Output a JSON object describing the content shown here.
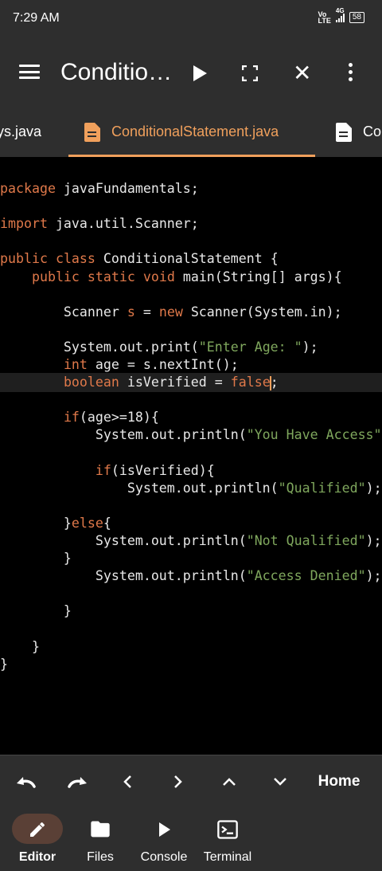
{
  "status": {
    "time": "7:29 AM",
    "volte_top": "Vo",
    "volte_bottom": "LTE",
    "network": "4G",
    "battery": "58"
  },
  "app_bar": {
    "title": "Conditio…"
  },
  "tabs": [
    {
      "label": "ys.java"
    },
    {
      "label": "ConditionalStatement.java"
    },
    {
      "label": "Co"
    }
  ],
  "code": [
    [
      {
        "t": "package",
        "c": "kw"
      },
      {
        "t": " javaFundamentals;"
      }
    ],
    [],
    [
      {
        "t": "import",
        "c": "kw"
      },
      {
        "t": " java.util.Scanner;"
      }
    ],
    [],
    [
      {
        "t": "public",
        "c": "kw"
      },
      {
        "t": " "
      },
      {
        "t": "class",
        "c": "kw"
      },
      {
        "t": " ConditionalStatement {"
      }
    ],
    [
      {
        "t": "    "
      },
      {
        "t": "public",
        "c": "kw"
      },
      {
        "t": " "
      },
      {
        "t": "static",
        "c": "kw"
      },
      {
        "t": " "
      },
      {
        "t": "void",
        "c": "kw"
      },
      {
        "t": " main(String[] args){"
      }
    ],
    [],
    [
      {
        "t": "        Scanner "
      },
      {
        "t": "s",
        "c": "kw"
      },
      {
        "t": " = "
      },
      {
        "t": "new",
        "c": "kw"
      },
      {
        "t": " Scanner(System.in);"
      }
    ],
    [],
    [
      {
        "t": "        System.out.print("
      },
      {
        "t": "\"Enter Age: \"",
        "c": "str"
      },
      {
        "t": ");"
      }
    ],
    [
      {
        "t": "        "
      },
      {
        "t": "int",
        "c": "kw"
      },
      {
        "t": " age = s.nextInt();"
      }
    ],
    [
      {
        "t": "        "
      },
      {
        "t": "boolean",
        "c": "kw"
      },
      {
        "t": " isVerified = "
      },
      {
        "t": "false",
        "c": "kw"
      },
      {
        "t": "",
        "c": "cursor"
      },
      {
        "t": ";"
      }
    ],
    [],
    [
      {
        "t": "        "
      },
      {
        "t": "if",
        "c": "kw"
      },
      {
        "t": "(age>=18){"
      }
    ],
    [
      {
        "t": "            System.out.println("
      },
      {
        "t": "\"You Have Access\"",
        "c": "str"
      }
    ],
    [],
    [
      {
        "t": "            "
      },
      {
        "t": "if",
        "c": "kw"
      },
      {
        "t": "(isVerified){"
      }
    ],
    [
      {
        "t": "                System.out.println("
      },
      {
        "t": "\"Qualified\"",
        "c": "str"
      },
      {
        "t": ");"
      }
    ],
    [],
    [
      {
        "t": "        }"
      },
      {
        "t": "else",
        "c": "kw"
      },
      {
        "t": "{"
      }
    ],
    [
      {
        "t": "            System.out.println("
      },
      {
        "t": "\"Not Qualified\"",
        "c": "str"
      },
      {
        "t": ");"
      }
    ],
    [
      {
        "t": "        }"
      }
    ],
    [
      {
        "t": "            System.out.println("
      },
      {
        "t": "\"Access Denied\"",
        "c": "str"
      },
      {
        "t": ");"
      }
    ],
    [],
    [
      {
        "t": "        }"
      }
    ],
    [],
    [
      {
        "t": "    }"
      }
    ],
    [
      {
        "t": "}"
      }
    ]
  ],
  "toolbar": {
    "home_label": "Home"
  },
  "bottom_nav": [
    {
      "label": "Editor",
      "icon": "pencil-icon",
      "active": true
    },
    {
      "label": "Files",
      "icon": "folder-icon",
      "active": false
    },
    {
      "label": "Console",
      "icon": "play-icon",
      "active": false
    },
    {
      "label": "Terminal",
      "icon": "terminal-icon",
      "active": false
    }
  ],
  "colors": {
    "accent": "#f0a05c",
    "keyword": "#e0794a",
    "string": "#7fa75d",
    "chrome": "#2e2e2e"
  }
}
